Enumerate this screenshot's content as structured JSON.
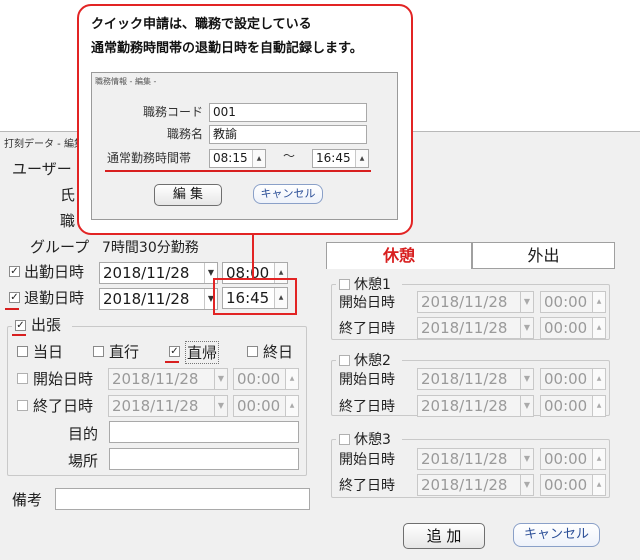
{
  "window": {
    "title": "打刻データ - 編集 -",
    "user_label": "ユーザー",
    "name_label": "氏",
    "job_label": "職",
    "group_label": "グループ",
    "group_value": "7時間30分勤務"
  },
  "attendance": {
    "check_mark": "✓",
    "label": "出勤日時",
    "date": "2018/11/28",
    "time": "08:00"
  },
  "leave": {
    "check_mark": "✓",
    "label": "退勤日時",
    "date": "2018/11/28",
    "time": "16:45"
  },
  "trip": {
    "check_mark": "✓",
    "label": "出張",
    "options": [
      {
        "label": "当日",
        "check_mark": ""
      },
      {
        "label": "直行",
        "check_mark": ""
      },
      {
        "label": "直帰",
        "check_mark": "✓"
      },
      {
        "label": "終日",
        "check_mark": ""
      }
    ],
    "start_label": "開始日時",
    "start_date": "2018/11/28",
    "start_time": "00:00",
    "end_label": "終了日時",
    "end_date": "2018/11/28",
    "end_time": "00:00",
    "purpose_label": "目的",
    "place_label": "場所",
    "purpose_value": "",
    "place_value": ""
  },
  "note": {
    "label": "備考",
    "value": ""
  },
  "tabs": [
    {
      "label": "休憩",
      "active": true
    },
    {
      "label": "外出",
      "active": false
    }
  ],
  "breaks": [
    {
      "label": "休憩1",
      "start_label": "開始日時",
      "end_label": "終了日時",
      "start_date": "2018/11/28",
      "start_time": "00:00",
      "end_date": "2018/11/28",
      "end_time": "00:00"
    },
    {
      "label": "休憩2",
      "start_label": "開始日時",
      "end_label": "終了日時",
      "start_date": "2018/11/28",
      "start_time": "00:00",
      "end_date": "2018/11/28",
      "end_time": "00:00"
    },
    {
      "label": "休憩3",
      "start_label": "開始日時",
      "end_label": "終了日時",
      "start_date": "2018/11/28",
      "start_time": "00:00",
      "end_date": "2018/11/28",
      "end_time": "00:00"
    }
  ],
  "buttons": {
    "add": "追 加",
    "cancel": "キャンセル"
  },
  "callout": {
    "line1": "クイック申請は、職務で設定している",
    "line2": "通常勤務時間帯の退勤日時を自動記録します。",
    "mini_title": "職務情報 - 編集 -",
    "job_code_label": "職務コード",
    "job_code_value": "001",
    "job_name_label": "職務名",
    "job_name_value": "教諭",
    "hours_label": "通常勤務時間帯",
    "hours_start": "08:15",
    "hours_tilde": "～",
    "hours_end": "16:45",
    "edit_button": "編 集",
    "cancel_button": "キャンセル"
  },
  "colors": {
    "accent_red": "#e22424",
    "button_blue_text": "#2c4f98"
  }
}
